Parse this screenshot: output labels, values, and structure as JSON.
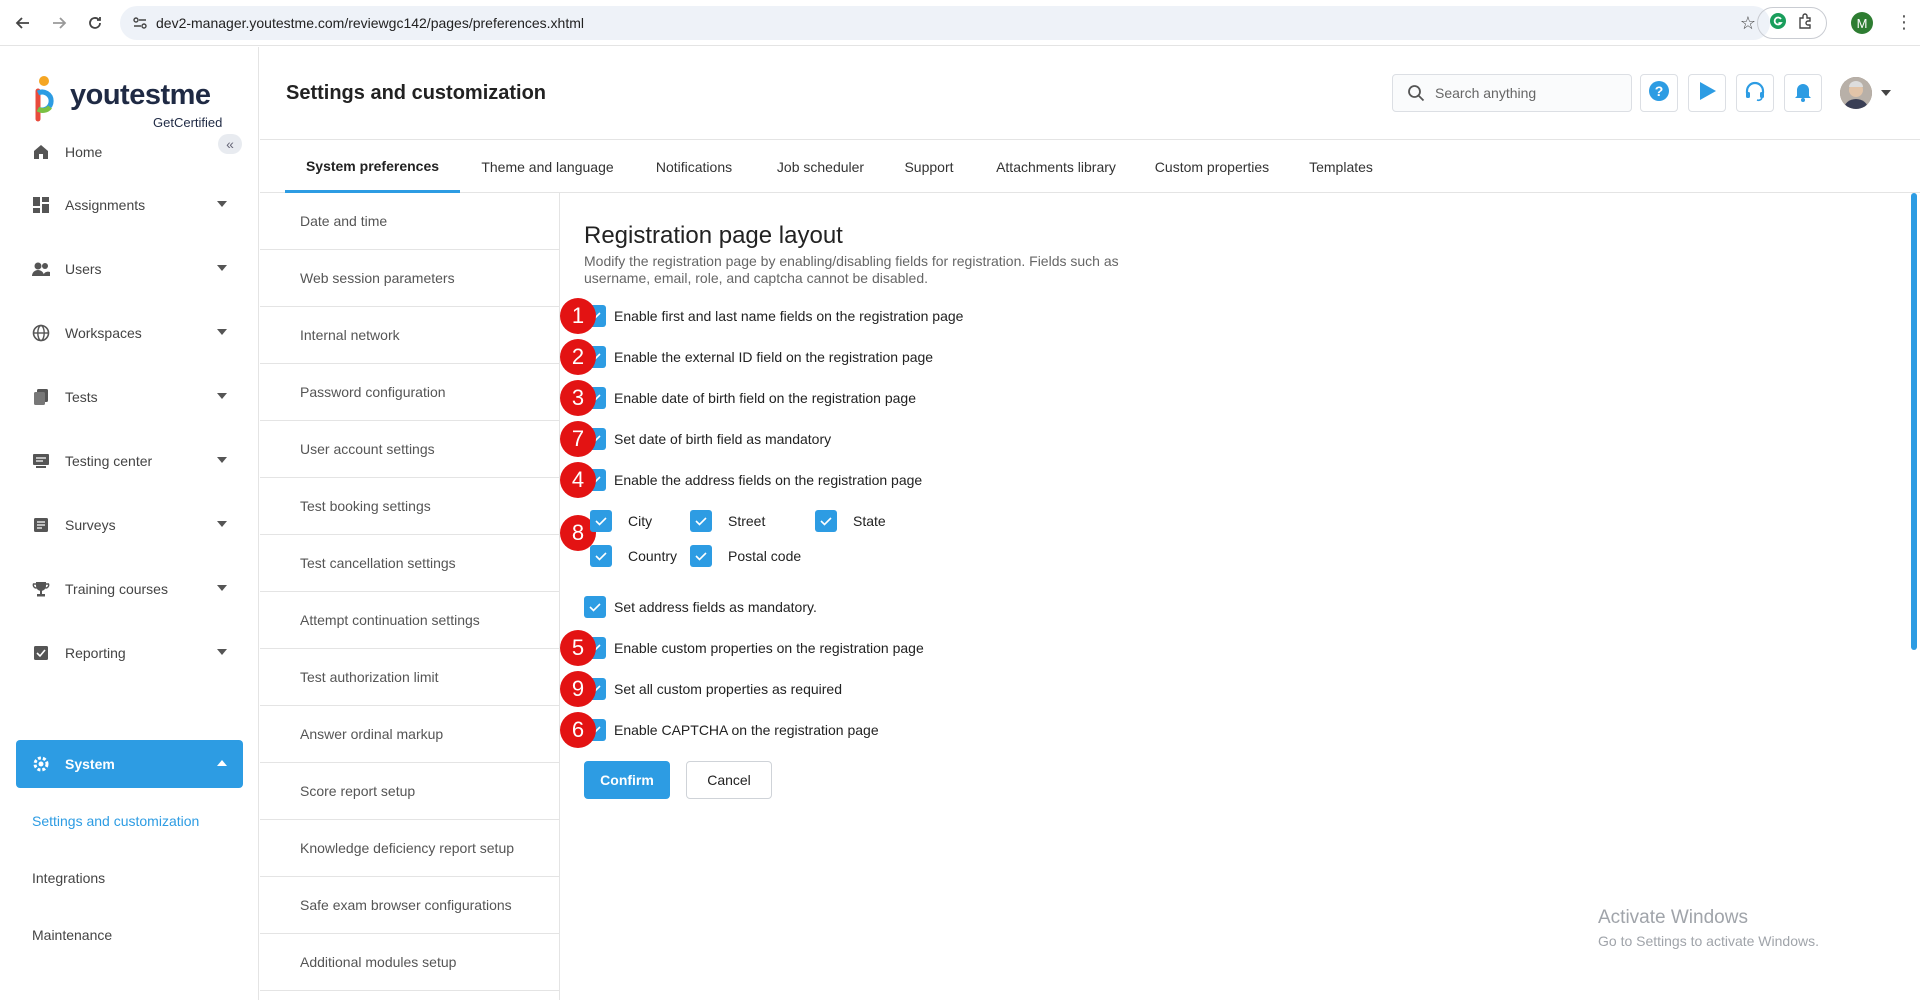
{
  "browser": {
    "url": "dev2-manager.youtestme.com/reviewgc142/pages/preferences.xhtml",
    "profile_initial": "M"
  },
  "brand": {
    "name": "youtestme",
    "subtitle": "GetCertified",
    "accent_color": "#2d9ce3"
  },
  "sidebar": {
    "items": [
      {
        "label": "Home",
        "icon": "home-icon"
      },
      {
        "label": "Assignments",
        "icon": "dashboard-icon"
      },
      {
        "label": "Users",
        "icon": "users-icon"
      },
      {
        "label": "Workspaces",
        "icon": "globe-icon"
      },
      {
        "label": "Tests",
        "icon": "tests-icon"
      },
      {
        "label": "Testing center",
        "icon": "testing-center-icon"
      },
      {
        "label": "Surveys",
        "icon": "survey-icon"
      },
      {
        "label": "Training courses",
        "icon": "trophy-icon"
      },
      {
        "label": "Reporting",
        "icon": "report-icon"
      },
      {
        "label": "System",
        "icon": "gear-icon"
      }
    ],
    "sub_items": [
      {
        "label": "Settings and customization"
      },
      {
        "label": "Integrations"
      },
      {
        "label": "Maintenance"
      }
    ]
  },
  "header": {
    "title": "Settings and customization",
    "search_placeholder": "Search anything"
  },
  "tabs": [
    {
      "label": "System preferences"
    },
    {
      "label": "Theme and language"
    },
    {
      "label": "Notifications"
    },
    {
      "label": "Job scheduler"
    },
    {
      "label": "Support"
    },
    {
      "label": "Attachments library"
    },
    {
      "label": "Custom properties"
    },
    {
      "label": "Templates"
    }
  ],
  "submenu": [
    "Date and time",
    "Web session parameters",
    "Internal network",
    "Password configuration",
    "User account settings",
    "Test booking settings",
    "Test cancellation settings",
    "Attempt continuation settings",
    "Test authorization limit",
    "Answer ordinal markup",
    "Score report setup",
    "Knowledge deficiency report setup",
    "Safe exam browser configurations",
    "Additional modules setup"
  ],
  "content": {
    "title": "Registration page layout",
    "description": "Modify the registration page by enabling/disabling fields for registration. Fields such as username, email, role, and captcha cannot be disabled.",
    "options": [
      {
        "label": "Enable first and last name fields on the registration page",
        "checked": true,
        "marker": "1"
      },
      {
        "label": "Enable the external ID field on the registration page",
        "checked": true,
        "marker": "2"
      },
      {
        "label": "Enable date of birth field on the registration page",
        "checked": true,
        "marker": "3"
      },
      {
        "label": "Set date of birth field as mandatory",
        "checked": true,
        "marker": "7"
      },
      {
        "label": "Enable the address fields on the registration page",
        "checked": true,
        "marker": "4"
      },
      {
        "label": "Set address fields as mandatory.",
        "checked": true,
        "marker": ""
      },
      {
        "label": "Enable custom properties on the registration page",
        "checked": true,
        "marker": "5"
      },
      {
        "label": "Set all custom properties as required",
        "checked": true,
        "marker": "9"
      },
      {
        "label": "Enable CAPTCHA on the registration page",
        "checked": true,
        "marker": "6"
      }
    ],
    "address_marker": "8",
    "address_fields": [
      {
        "label": "City",
        "checked": true
      },
      {
        "label": "Street",
        "checked": true
      },
      {
        "label": "State",
        "checked": true
      },
      {
        "label": "Country",
        "checked": true
      },
      {
        "label": "Postal code",
        "checked": true
      }
    ],
    "confirm_label": "Confirm",
    "cancel_label": "Cancel"
  },
  "watermark": {
    "line1": "Activate Windows",
    "line2": "Go to Settings to activate Windows."
  }
}
